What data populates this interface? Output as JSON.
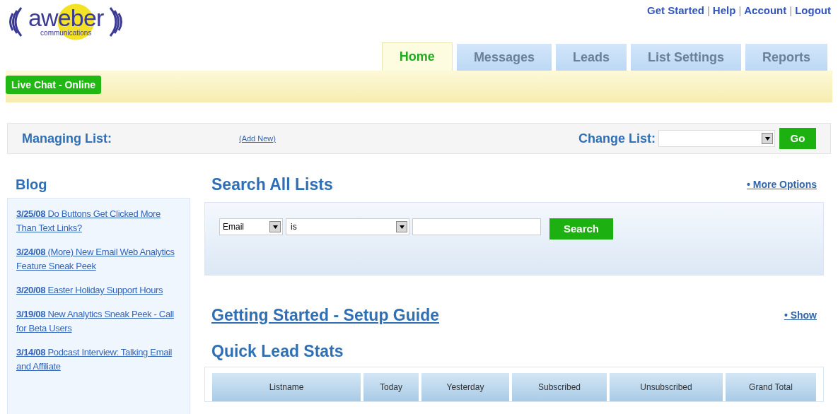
{
  "logo": {
    "name": "aweber",
    "tagline": "communications"
  },
  "top_links": {
    "separator": "|",
    "items": [
      "Get Started",
      "Help",
      "Account",
      "Logout"
    ]
  },
  "tabs": [
    {
      "label": "Home",
      "selected": true
    },
    {
      "label": "Messages",
      "selected": false
    },
    {
      "label": "Leads",
      "selected": false
    },
    {
      "label": "List Settings",
      "selected": false
    },
    {
      "label": "Reports",
      "selected": false
    }
  ],
  "live_chat": "Live Chat - Online",
  "managing_list": {
    "label": "Managing List:",
    "add_new": "(Add New)"
  },
  "change_list": {
    "label": "Change List:",
    "button": "Go"
  },
  "blog": {
    "title": "Blog",
    "posts": [
      {
        "date": "3/25/08",
        "title": "Do Buttons Get Clicked More Than Text Links?"
      },
      {
        "date": "3/24/08",
        "title": "(More) New Email Web Analytics Feature Sneak Peek"
      },
      {
        "date": "3/20/08",
        "title": "Easter Holiday Support Hours"
      },
      {
        "date": "3/19/08",
        "title": "New Analytics Sneak Peek - Call for Beta Users"
      },
      {
        "date": "3/14/08",
        "title": "Podcast Interview: Talking Email and Affiliate"
      }
    ]
  },
  "search": {
    "title": "Search All Lists",
    "more_options": "• More Options",
    "field_select": "Email",
    "operator_select": "is",
    "button": "Search"
  },
  "setup_guide": {
    "title": "Getting Started - Setup Guide",
    "show": "• Show"
  },
  "stats": {
    "title": "Quick Lead Stats",
    "columns": [
      "Listname",
      "Today",
      "Yesterday",
      "Subscribed",
      "Unsubscribed",
      "Grand Total"
    ]
  }
}
